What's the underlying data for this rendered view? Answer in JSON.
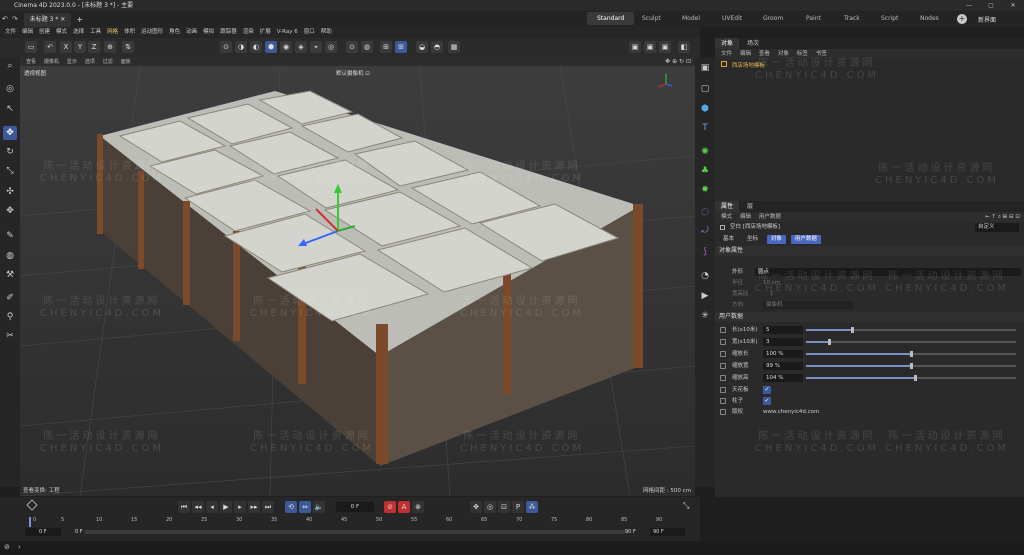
{
  "window": {
    "title": "Cinema 4D 2023.0.0 - [未标题 3 *] - 主要",
    "controls": [
      "—",
      "▢",
      "✕"
    ]
  },
  "tabs": {
    "doc": "未标题 3 *",
    "add": "+",
    "layouts": [
      "Standard",
      "Sculpt",
      "Model",
      "UVEdit",
      "Groom",
      "Paint",
      "Track",
      "Script",
      "Nodes"
    ],
    "active_layout": "Standard",
    "new_interface": "新界面"
  },
  "menu": [
    "文件",
    "编辑",
    "创建",
    "模式",
    "选择",
    "工具",
    "网格",
    "体积",
    "运动图形",
    "角色",
    "动画",
    "模拟",
    "跟踪器",
    "渲染",
    "扩展",
    "V-Ray 6",
    "窗口",
    "帮助"
  ],
  "toolbar": {
    "axis": [
      "X",
      "Y",
      "Z"
    ]
  },
  "viewport": {
    "menu": [
      "查看",
      "摄像机",
      "显示",
      "选项",
      "过滤",
      "面板"
    ],
    "name": "透视视图",
    "camera": "默认摄像机 ⊡",
    "status_left": "查看变换: 工程",
    "status_right": "网格间距 : 500 cm"
  },
  "left_tools": {
    "move_label": "移动"
  },
  "timeline": {
    "ticks": [
      "0",
      "5",
      "10",
      "15",
      "20",
      "25",
      "30",
      "35",
      "40",
      "45",
      "50",
      "55",
      "60",
      "65",
      "70",
      "75",
      "80",
      "85",
      "90"
    ],
    "current_frame": "0 F",
    "start": "0 F",
    "start2": "0 F",
    "end": "90 F",
    "end2": "90 F"
  },
  "object_panel": {
    "tabs": [
      "对象",
      "场次"
    ],
    "menu": [
      "文件",
      "编辑",
      "查看",
      "对象",
      "标签",
      "书签"
    ],
    "item": "西店场地模板"
  },
  "attr_panel": {
    "tabs": [
      "属性",
      "层"
    ],
    "menu": [
      "模式",
      "编辑",
      "用户数据"
    ],
    "object_line": "空白 [西店场地模板]",
    "custom": "自定义",
    "subtabs": [
      "基本",
      "坐标",
      "对象",
      "用户数据"
    ],
    "section1": "对象属性",
    "display_label": "外形",
    "display_value": "圆点",
    "radius_label": "半径",
    "radius_value": "10 cm",
    "aspect_label": "宽高比",
    "aspect_value": "1",
    "orientation_label": "方向",
    "orientation_value": "摄像机",
    "section2": "用户数据",
    "rows": [
      {
        "label": "长(x10米)",
        "value": "5",
        "level": 0.22
      },
      {
        "label": "宽(x10米)",
        "value": "3",
        "level": 0.11
      },
      {
        "label": "缩放长",
        "value": "100 %",
        "level": 0.5
      },
      {
        "label": "缩放宽",
        "value": "99 %",
        "level": 0.5
      },
      {
        "label": "缩放高",
        "value": "104 %",
        "level": 0.52
      }
    ],
    "check1": "天花板",
    "check2": "柱子",
    "copyright_label": "版权",
    "copyright_value": "www.chenyic4d.com"
  },
  "watermark": {
    "line1": "陈一活动设计资源网",
    "line2": "CHENYIC4D.COM"
  }
}
